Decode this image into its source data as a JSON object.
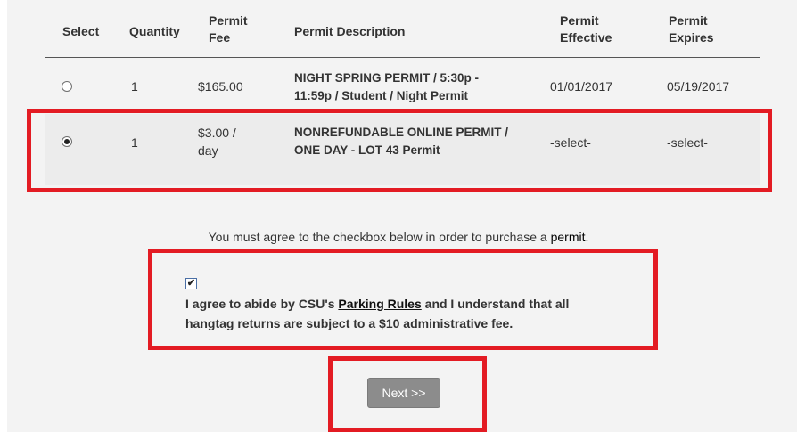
{
  "table": {
    "headers": {
      "select": "Select",
      "quantity": "Quantity",
      "fee_line1": "Permit",
      "fee_line2": "Fee",
      "description": "Permit Description",
      "effective_line1": "Permit",
      "effective_line2": "Effective",
      "expires_line1": "Permit",
      "expires_line2": "Expires"
    },
    "rows": [
      {
        "selected": false,
        "quantity": "1",
        "fee_line1": "$165.00",
        "fee_line2": "",
        "desc_line1": "NIGHT SPRING PERMIT / 5:30p -",
        "desc_line2": "11:59p / Student / Night Permit",
        "effective": "01/01/2017",
        "expires": "05/19/2017"
      },
      {
        "selected": true,
        "quantity": "1",
        "fee_line1": "$3.00 /",
        "fee_line2": "day",
        "desc_line1": "NONREFUNDABLE ONLINE PERMIT /",
        "desc_line2": "ONE DAY - LOT 43 Permit",
        "effective": "-select-",
        "expires": "-select-"
      }
    ]
  },
  "notice": {
    "before": "You must agree to the checkbox below in order to purchase a ",
    "highlight": "permit",
    "after": "."
  },
  "agreement": {
    "checked": true,
    "check_glyph": "✔",
    "text_before": "I agree to abide by CSU's ",
    "link_text": "Parking Rules",
    "text_after": " and I understand that all",
    "line2": "hangtag returns are subject to a $10 administrative fee."
  },
  "next_button": {
    "label": "Next >>"
  },
  "colors": {
    "highlight_red": "#e31b23",
    "button_gray": "#8c8c8c",
    "panel_gray": "#f3f3f3"
  }
}
